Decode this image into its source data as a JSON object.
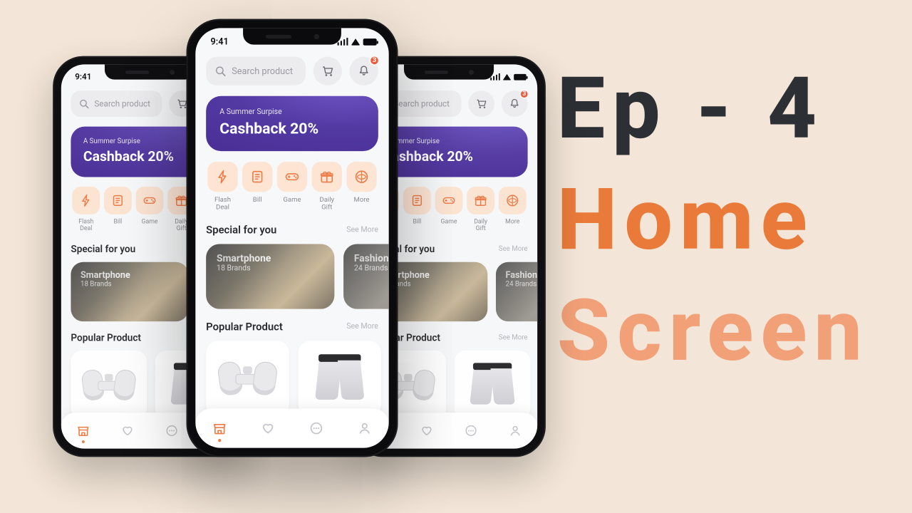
{
  "title": {
    "line1": "Ep - 4",
    "line2": "Home",
    "line3": "Screen"
  },
  "status": {
    "time": "9:41"
  },
  "search": {
    "placeholder": "Search product"
  },
  "topbar": {
    "notif_badge": "3"
  },
  "promo": {
    "subtitle": "A Summer Surpise",
    "headline": "Cashback 20%"
  },
  "categories": [
    {
      "icon": "flash-icon",
      "label": "Flash\nDeal"
    },
    {
      "icon": "bill-icon",
      "label": "Bill"
    },
    {
      "icon": "game-icon",
      "label": "Game"
    },
    {
      "icon": "gift-icon",
      "label": "Daily\nGift"
    },
    {
      "icon": "more-icon",
      "label": "More"
    }
  ],
  "sections": {
    "special": {
      "title": "Special for you",
      "more": "See More",
      "cards": [
        {
          "title": "Smartphone",
          "subtitle": "18 Brands"
        },
        {
          "title": "Fashion",
          "subtitle": "24 Brands"
        }
      ]
    },
    "popular": {
      "title": "Popular Product",
      "more": "See More"
    }
  },
  "colors": {
    "accent": "#ee7a45",
    "promo": "#533aa3",
    "bg": "#f3e6d8"
  }
}
